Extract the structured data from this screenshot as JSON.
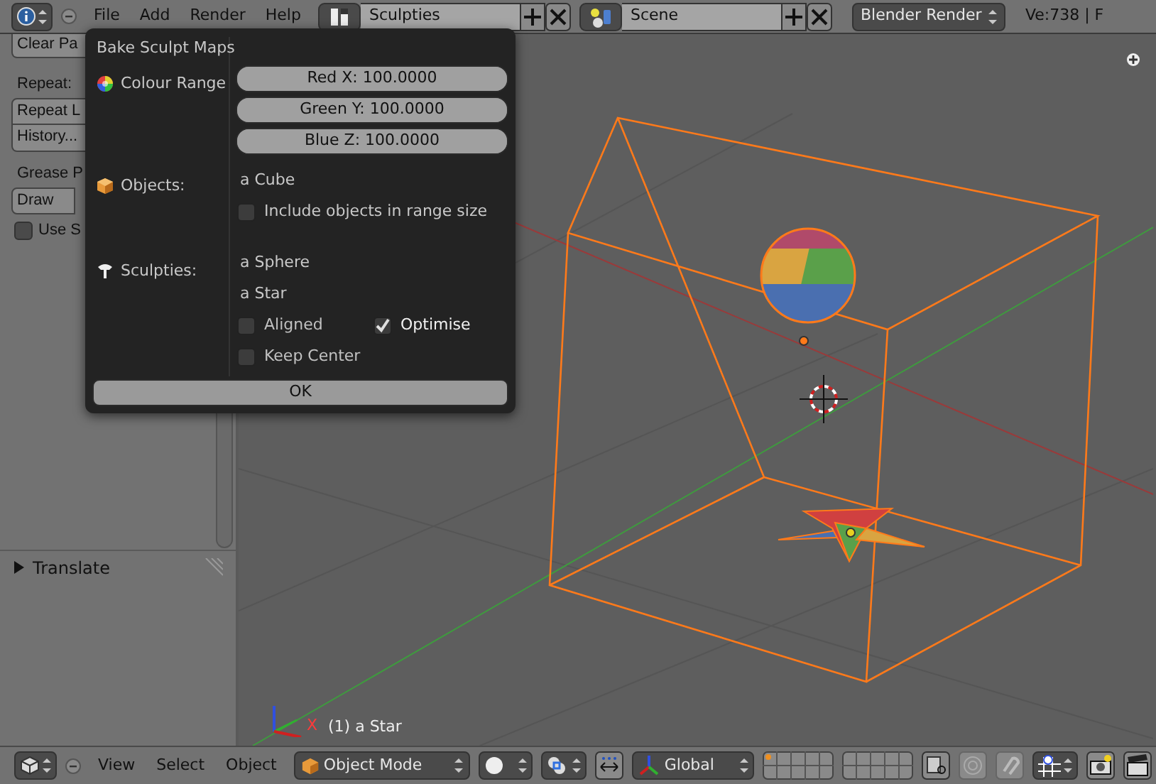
{
  "top_header": {
    "menus": [
      "File",
      "Add",
      "Render",
      "Help"
    ],
    "screen_field": "Sculpties",
    "scene_field": "Scene",
    "engine": "Blender Render",
    "stats": "Ve:738 | F"
  },
  "tool_panel": {
    "clear_button": "Clear Pa",
    "repeat_label": "Repeat:",
    "repeat_buttons": [
      "Repeat L",
      "History..."
    ],
    "grease_label": "Grease P",
    "grease_buttons": [
      "Draw"
    ],
    "sketch_option": {
      "label": "Use S",
      "checked": false
    },
    "operator_panel": {
      "label": "Translate",
      "expanded": false
    }
  },
  "viewport": {
    "object_label": "(1) a Star",
    "axis_label": "X"
  },
  "dialog": {
    "title": "Bake Sculpt Maps",
    "colour_label": "Colour Range",
    "sliders": [
      {
        "label": "Red X: 100.0000",
        "level": 1
      },
      {
        "label": "Green Y: 100.0000",
        "level": 1
      },
      {
        "label": "Blue Z: 100.0000",
        "level": 1
      }
    ],
    "objects_label": "Objects:",
    "objects": [
      "a Cube"
    ],
    "include_option": {
      "label": "Include objects in range size",
      "checked": false
    },
    "sculpties_label": "Sculpties:",
    "sculpties": [
      "a Sphere",
      "a Star"
    ],
    "options": [
      {
        "label": "Aligned",
        "checked": false
      },
      {
        "label": "Optimise",
        "checked": true
      },
      {
        "label": "Keep Center",
        "checked": false
      }
    ],
    "ok_button": "OK"
  },
  "bottom_header": {
    "menus": [
      "View",
      "Select",
      "Object"
    ],
    "mode": "Object Mode",
    "orientation": "Global"
  }
}
